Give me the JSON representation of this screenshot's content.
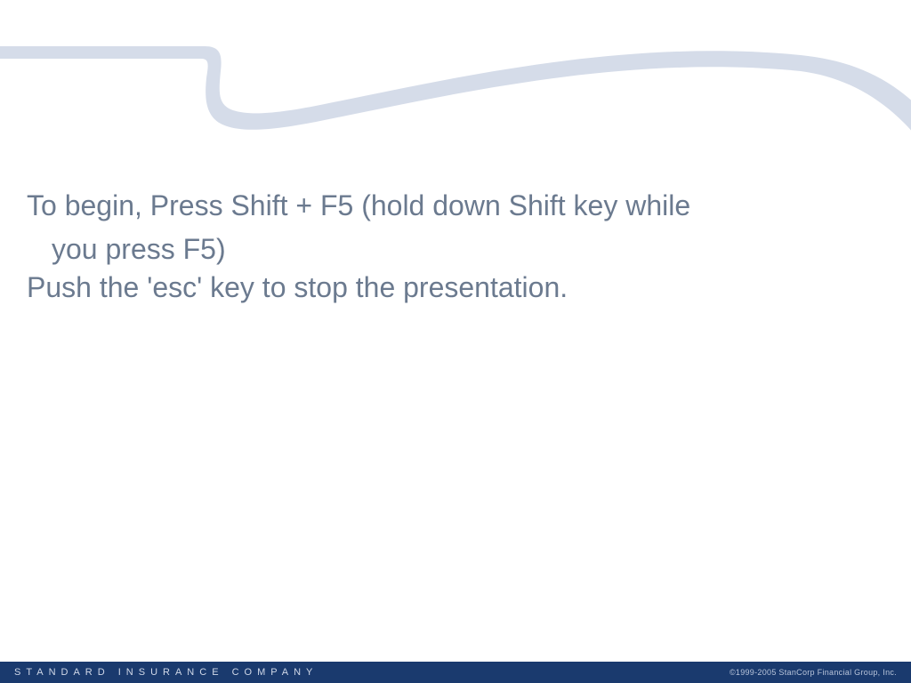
{
  "content": {
    "line1": "To begin, Press Shift + F5 (hold down Shift key while",
    "line1_cont": "you press F5)",
    "line2": "Push the 'esc' key to stop the presentation."
  },
  "footer": {
    "company": "STANDARD INSURANCE COMPANY",
    "copyright": "©1999-2005 StanCorp Financial Group, Inc."
  },
  "colors": {
    "text": "#6b7a8f",
    "footer_bg": "#1a3a6e",
    "swoosh": "#d5dce9"
  }
}
